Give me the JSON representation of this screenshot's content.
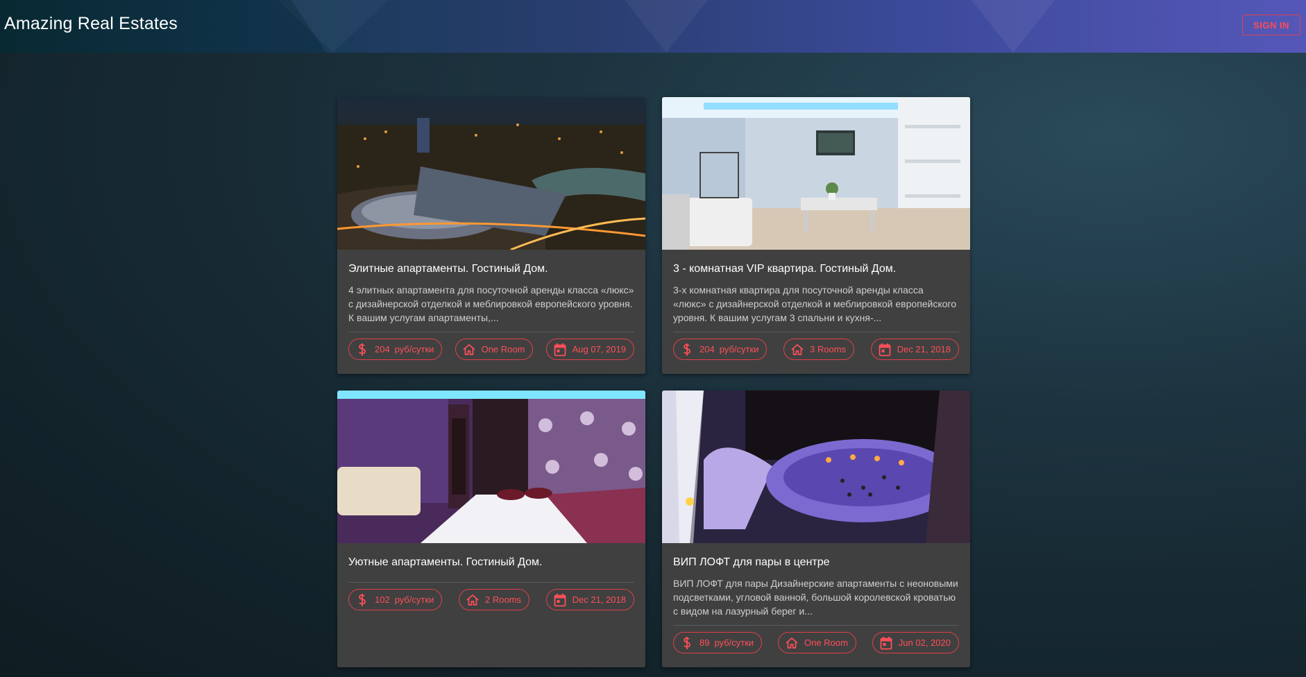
{
  "header": {
    "title": "Amazing Real Estates",
    "sign_in_label": "SIGN IN"
  },
  "theme": {
    "accent": "#ff4f59",
    "card_bg": "#404040"
  },
  "listings": [
    {
      "title": "Элитные апартаменты. Гостиный Дом.",
      "description": "4 элитных апартамента для посуточной аренды класса «люкс» с дизайнерской отделкой и меблировкой европейского уровня. К вашим услугам апартаменты,...",
      "price": "204",
      "price_unit": "руб/сутки",
      "rooms": "One Room",
      "date": "Aug 07, 2019",
      "image": "night-city-aerial"
    },
    {
      "title": "3 - комнатная VIP квартира. Гостиный Дом.",
      "description": "3-х комнатная квартира для посуточной аренды класса «люкс» с дизайнерской отделкой и меблировкой европейского уровня. К вашим услугам 3 спальни и кухня-...",
      "price": "204",
      "price_unit": "руб/сутки",
      "rooms": "3 Rooms",
      "date": "Dec 21, 2018",
      "image": "bright-living-room"
    },
    {
      "title": "Уютные апартаменты. Гостиный Дом.",
      "description": "",
      "price": "102",
      "price_unit": "руб/сутки",
      "rooms": "2 Rooms",
      "date": "Dec 21, 2018",
      "image": "purple-bedroom"
    },
    {
      "title": "ВИП ЛОФТ для пары в центре",
      "description": "ВИП ЛОФТ для пары Дизайнерские апартаменты с неоновыми подсветками, угловой ванной, большой королевской кроватью с видом на лазурный берег и...",
      "price": "89",
      "price_unit": "руб/сутки",
      "rooms": "One Room",
      "date": "Jun 02, 2020",
      "image": "jacuzzi-bathroom"
    }
  ],
  "icons": {
    "price": "dollar-icon",
    "rooms": "home-icon",
    "date": "calendar-icon"
  }
}
